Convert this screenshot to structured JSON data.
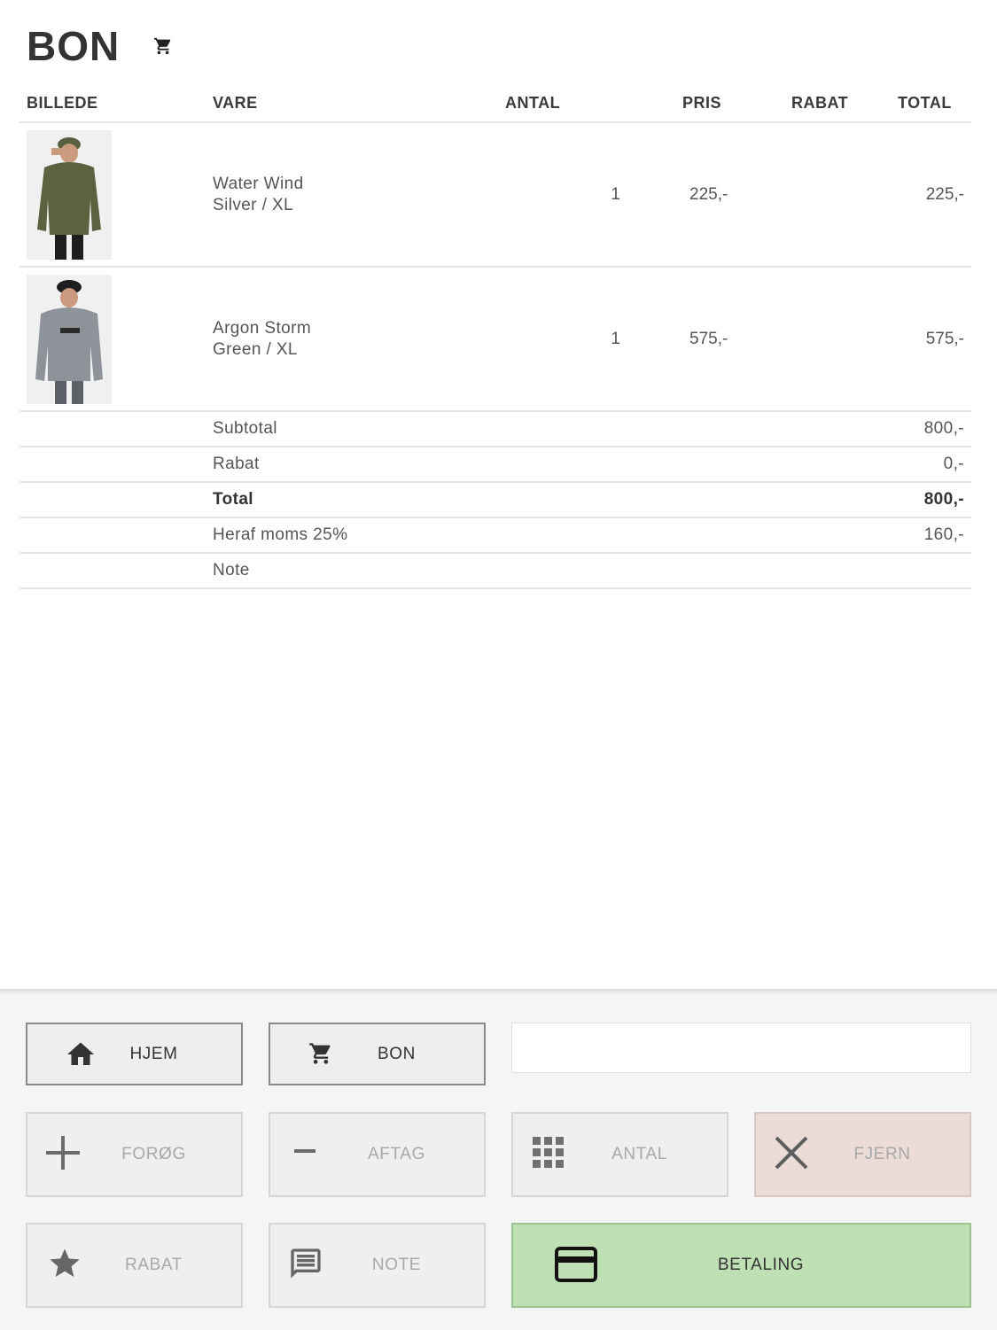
{
  "header": {
    "title": "BON",
    "cart_icon": "cart-icon"
  },
  "table": {
    "columns": {
      "image": "BILLEDE",
      "item": "VARE",
      "qty": "ANTAL",
      "price": "PRIS",
      "discount": "RABAT",
      "total": "TOTAL"
    },
    "items": [
      {
        "name": "Water Wind",
        "variant": "Silver / XL",
        "qty": "1",
        "price": "225,-",
        "discount": "",
        "total": "225,-"
      },
      {
        "name": "Argon Storm",
        "variant": "Green / XL",
        "qty": "1",
        "price": "575,-",
        "discount": "",
        "total": "575,-"
      }
    ]
  },
  "summary": {
    "subtotal": {
      "label": "Subtotal",
      "value": "800,-"
    },
    "discount": {
      "label": "Rabat",
      "value": "0,-"
    },
    "total": {
      "label": "Total",
      "value": "800,-"
    },
    "vat": {
      "label": "Heraf moms 25%",
      "value": "160,-"
    },
    "note": {
      "label": "Note",
      "value": ""
    }
  },
  "buttons": {
    "home": {
      "label": "HJEM",
      "icon": "home-icon"
    },
    "bon": {
      "label": "BON",
      "icon": "cart-icon"
    },
    "increase": {
      "label": "FORØG",
      "icon": "plus-icon"
    },
    "decrease": {
      "label": "AFTAG",
      "icon": "minus-icon"
    },
    "quantity": {
      "label": "ANTAL",
      "icon": "grid-icon"
    },
    "remove": {
      "label": "FJERN",
      "icon": "close-icon"
    },
    "discount": {
      "label": "RABAT",
      "icon": "star-icon"
    },
    "note": {
      "label": "NOTE",
      "icon": "message-icon"
    },
    "payment": {
      "label": "BETALING",
      "icon": "credit-card-icon"
    }
  },
  "entry": {
    "value": "",
    "placeholder": ""
  },
  "colors": {
    "payment_bg": "#bfe0b4",
    "remove_bg": "#ecdcd8",
    "panel_bg": "#f5f5f5"
  }
}
